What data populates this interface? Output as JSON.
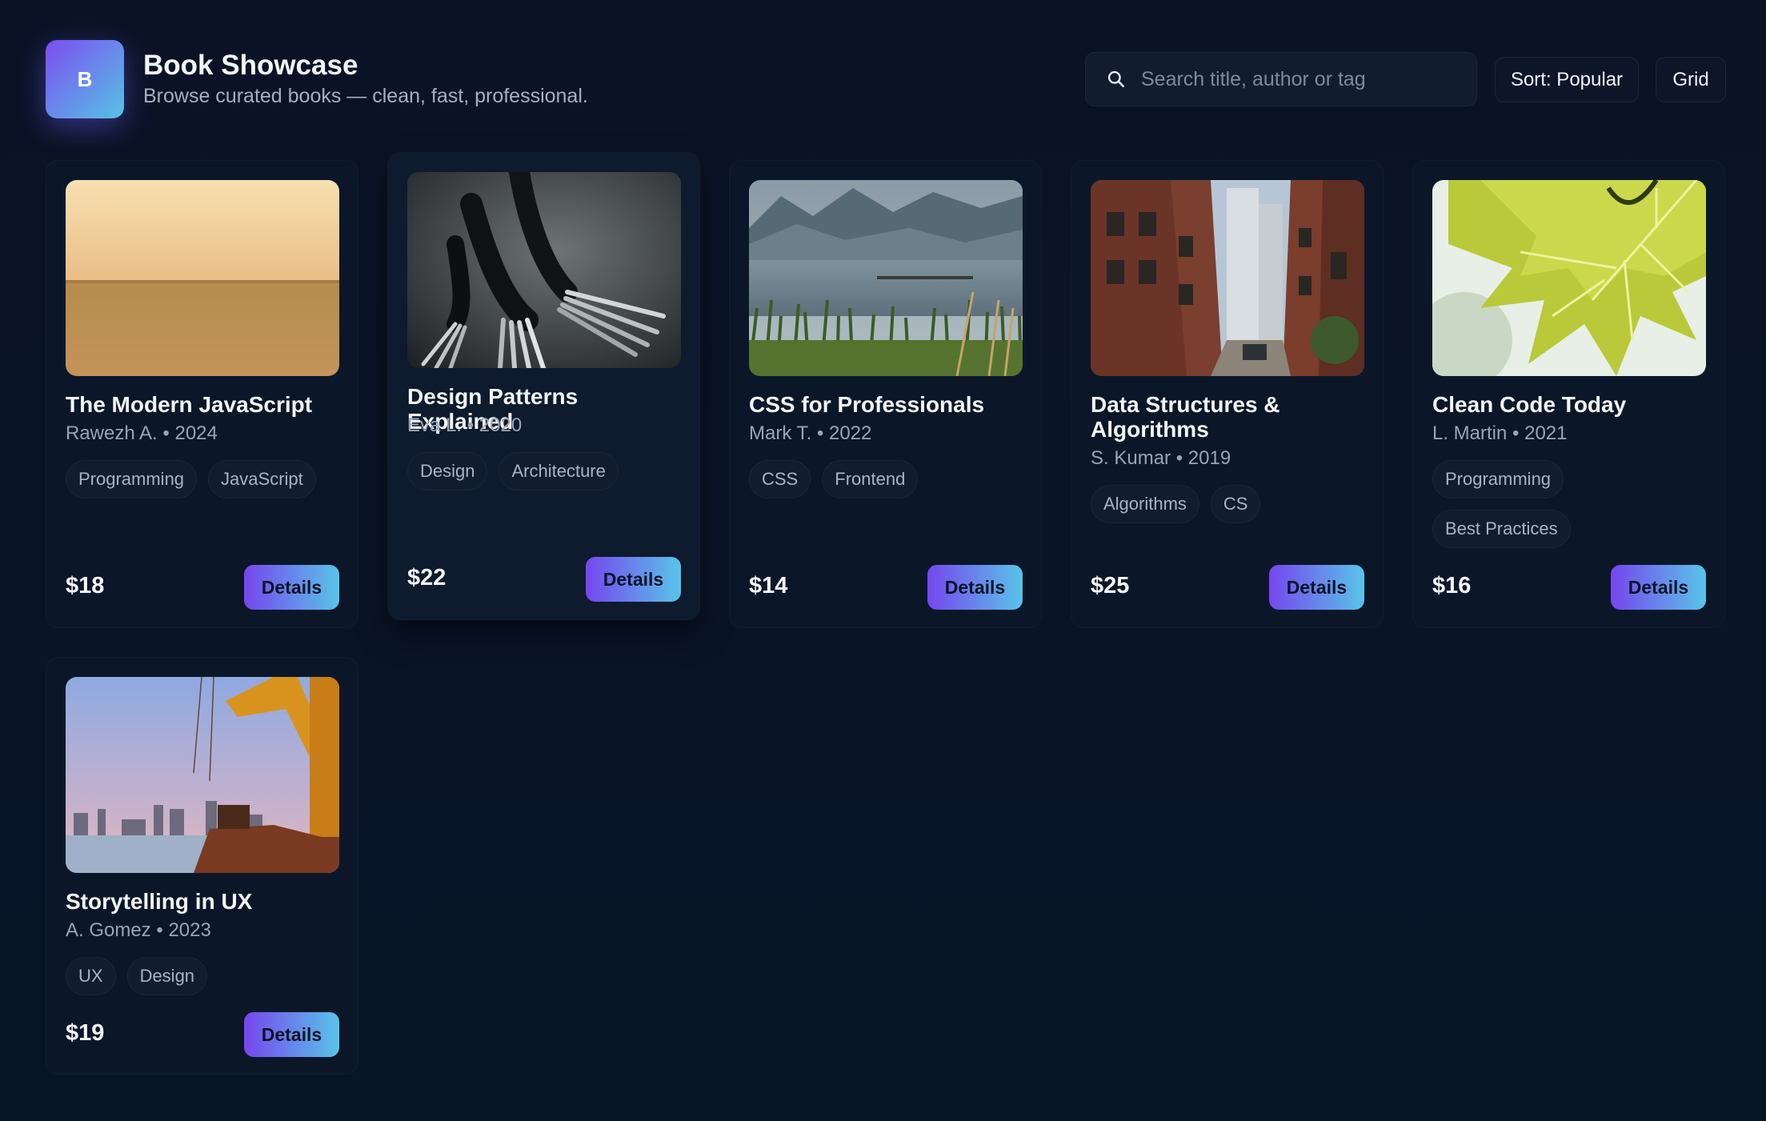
{
  "app": {
    "logo_letter": "B",
    "title": "Book Showcase",
    "subtitle": "Browse curated books — clean, fast, professional."
  },
  "search": {
    "placeholder": "Search title, author or tag",
    "value": ""
  },
  "toolbar": {
    "sort_label": "Sort: Popular",
    "view_label": "Grid"
  },
  "details_label": "Details",
  "books": [
    {
      "title": "The Modern JavaScript",
      "author": "Rawezh A.",
      "year": "2024",
      "meta": "Rawezh A. • 2024",
      "tags": [
        "Programming",
        "JavaScript"
      ],
      "price": "$18"
    },
    {
      "title": "Design Patterns Explained",
      "author": "Eva L.",
      "year": "2020",
      "meta": "Eva L. • 2020",
      "tags": [
        "Design",
        "Architecture"
      ],
      "price": "$22"
    },
    {
      "title": "CSS for Professionals",
      "author": "Mark T.",
      "year": "2022",
      "meta": "Mark T. • 2022",
      "tags": [
        "CSS",
        "Frontend"
      ],
      "price": "$14"
    },
    {
      "title": "Data Structures & Algorithms",
      "author": "S. Kumar",
      "year": "2019",
      "meta": "S. Kumar • 2019",
      "tags": [
        "Algorithms",
        "CS"
      ],
      "price": "$25"
    },
    {
      "title": "Clean Code Today",
      "author": "L. Martin",
      "year": "2021",
      "meta": "L. Martin • 2021",
      "tags": [
        "Programming",
        "Best Practices"
      ],
      "price": "$16"
    },
    {
      "title": "Storytelling in UX",
      "author": "A. Gomez",
      "year": "2023",
      "meta": "A. Gomez • 2023",
      "tags": [
        "UX",
        "Design"
      ],
      "price": "$19"
    }
  ],
  "colors": {
    "background": "#0a1424",
    "card": "#0b1729",
    "accent_start": "#7646ee",
    "accent_end": "#58c4e8",
    "text_muted": "#9aa4b4"
  },
  "icons": {
    "search": "search-icon"
  }
}
